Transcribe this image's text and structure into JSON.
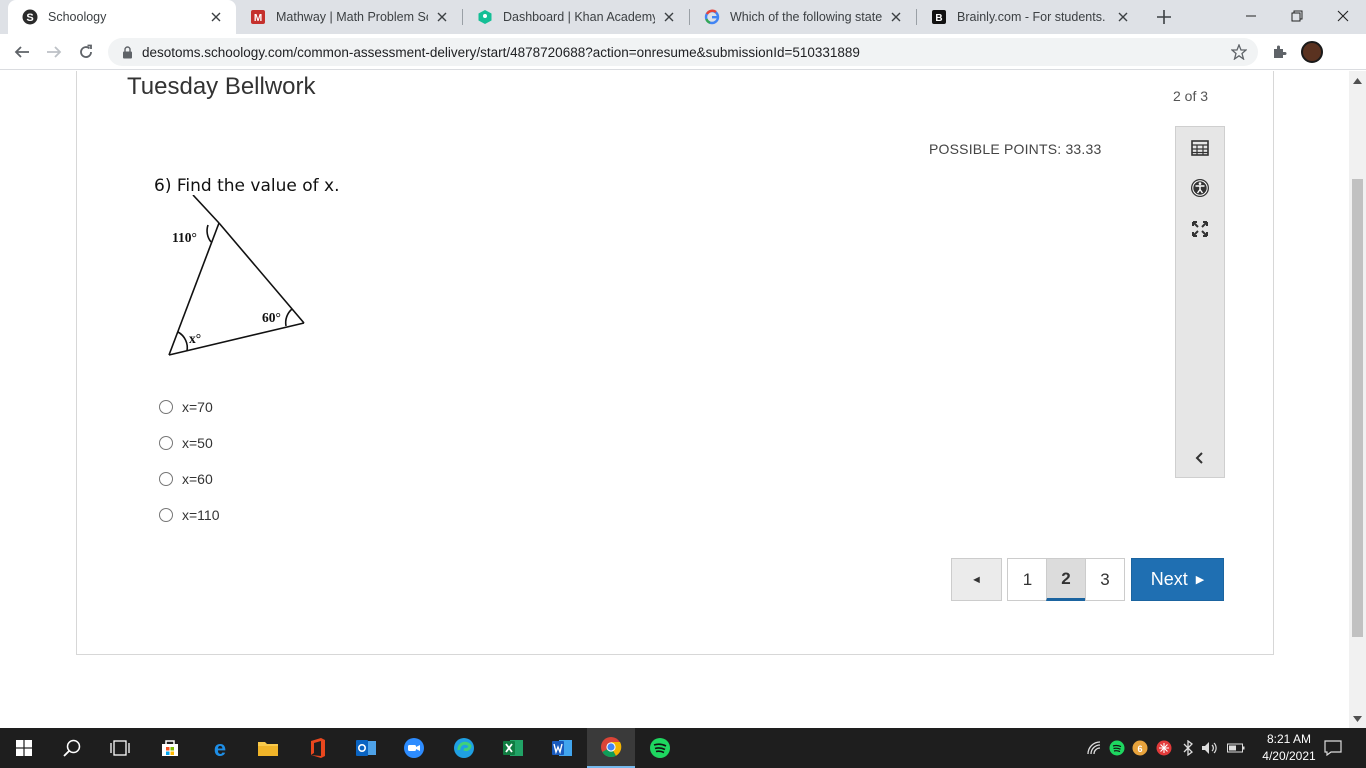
{
  "browser": {
    "tabs": [
      {
        "title": "Schoology",
        "active": true
      },
      {
        "title": "Mathway | Math Problem Solve",
        "active": false
      },
      {
        "title": "Dashboard | Khan Academy",
        "active": false
      },
      {
        "title": "Which of the following stateme",
        "active": false
      },
      {
        "title": "Brainly.com - For students. By",
        "active": false
      }
    ],
    "url": "desotoms.schoology.com/common-assessment-delivery/start/4878720688?action=onresume&submissionId=510331889"
  },
  "assessment": {
    "title": "Tuesday Bellwork",
    "counter": "2 of 3",
    "points": "POSSIBLE POINTS: 33.33",
    "question": "6) Find the value of x.",
    "figure": {
      "angle_top": "110°",
      "angle_right": "60°",
      "angle_left": "x°"
    },
    "choices": [
      {
        "label": "x=70"
      },
      {
        "label": "x=50"
      },
      {
        "label": "x=60"
      },
      {
        "label": "x=110"
      }
    ],
    "tools": [
      "calculator-icon",
      "accessibility-icon",
      "fullscreen-icon",
      "collapse-icon"
    ],
    "pager": {
      "prev": "◄",
      "pages": [
        "1",
        "2",
        "3"
      ],
      "current": "2",
      "next": "Next"
    }
  },
  "taskbar": {
    "time": "8:21 AM",
    "date": "4/20/2021",
    "apps": [
      "start",
      "search",
      "task-view",
      "store",
      "edge-legacy",
      "file-explorer",
      "office",
      "outlook",
      "zoom",
      "edge",
      "excel",
      "word",
      "chrome",
      "spotify"
    ]
  },
  "colors": {
    "primary_button": "#1f6fb2",
    "tab_strip": "#dee1e6",
    "taskbar": "#1e1e1e"
  }
}
